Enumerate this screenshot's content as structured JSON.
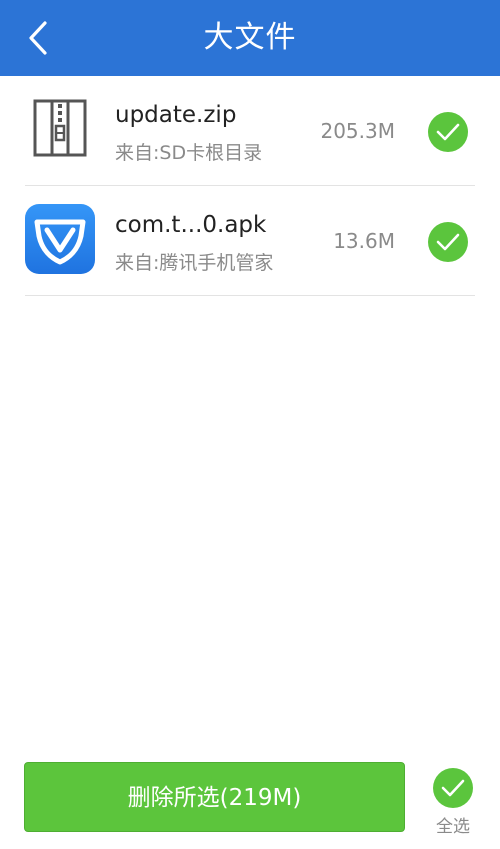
{
  "header": {
    "title": "大文件",
    "back_icon": "chevron-left-icon",
    "background": "#2c74d6"
  },
  "files": [
    {
      "name": "update.zip",
      "source": "来自:SD卡根目录",
      "size": "205.3M",
      "icon": "zip-archive-icon",
      "checked": true
    },
    {
      "name": "com.t...0.apk",
      "source": "来自:腾讯手机管家",
      "size": "13.6M",
      "icon": "tencent-shield-icon",
      "checked": true
    }
  ],
  "footer": {
    "delete_label": "删除所选(219M)",
    "select_all_label": "全选",
    "select_all_checked": true
  },
  "colors": {
    "accent_green": "#5bc53d",
    "header_blue": "#2c74d6",
    "app_icon_blue": "#2a86f0"
  }
}
